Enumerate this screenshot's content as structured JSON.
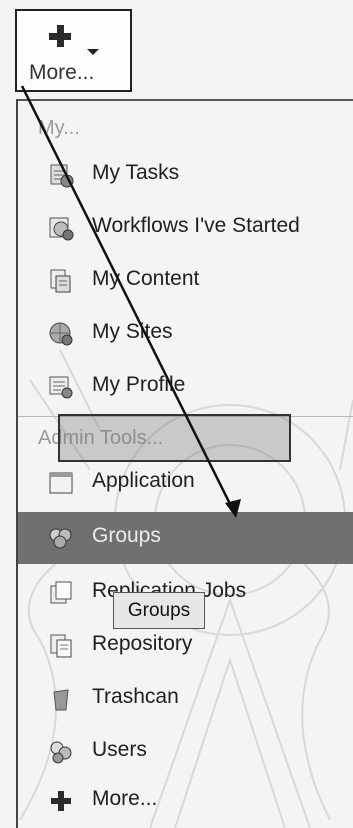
{
  "button": {
    "label": "More...",
    "icon": "plus-icon"
  },
  "menu": {
    "section_my": "My...",
    "my_items": [
      {
        "label": "My Tasks",
        "icon": "tasks-icon"
      },
      {
        "label": "Workflows I've Started",
        "icon": "workflow-icon"
      },
      {
        "label": "My Content",
        "icon": "content-icon"
      },
      {
        "label": "My Sites",
        "icon": "sites-icon"
      },
      {
        "label": "My Profile",
        "icon": "profile-icon"
      }
    ],
    "section_admin": "Admin Tools...",
    "admin_items": [
      {
        "label": "Application",
        "icon": "application-icon"
      },
      {
        "label": "Groups",
        "icon": "groups-icon",
        "highlighted": true
      },
      {
        "label": "Replication Jobs",
        "icon": "replication-icon"
      },
      {
        "label": "Repository",
        "icon": "repository-icon"
      },
      {
        "label": "Trashcan",
        "icon": "trashcan-icon"
      },
      {
        "label": "Users",
        "icon": "users-icon"
      }
    ],
    "footer_more": "More..."
  },
  "tooltip": "Groups",
  "colors": {
    "highlight": "#707070",
    "muted": "#9a9a9a"
  }
}
